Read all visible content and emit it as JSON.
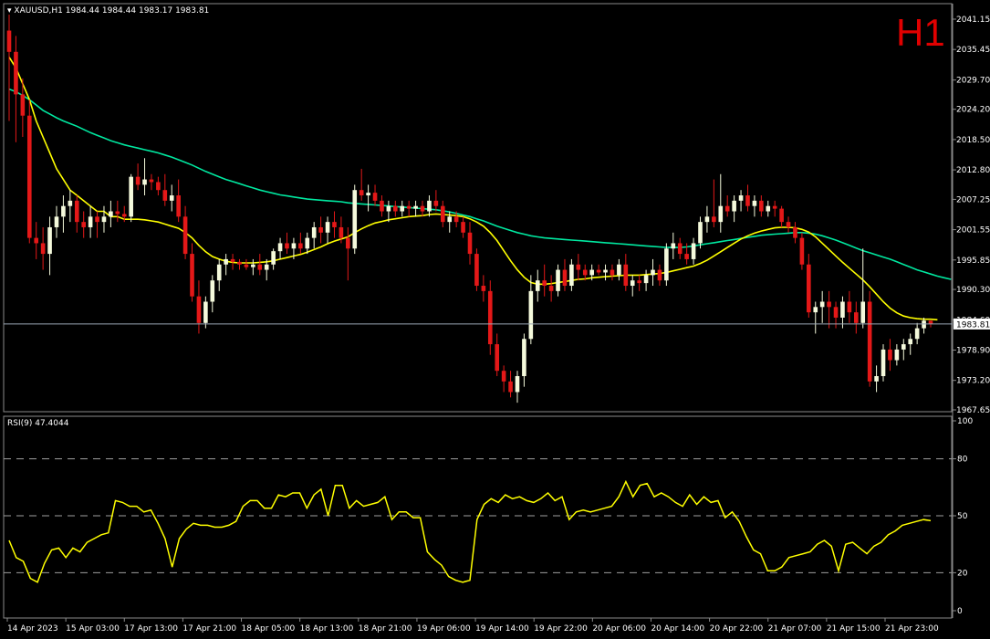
{
  "header": {
    "symbol": "XAUUSD,H1",
    "open": "1984.44",
    "high": "1984.44",
    "low": "1983.17",
    "close": "1983.81"
  },
  "timeframe_label": "H1",
  "price_axis": {
    "ticks": [
      "2041.15",
      "2035.45",
      "2029.70",
      "2024.20",
      "2018.50",
      "2012.80",
      "2007.25",
      "2001.55",
      "1995.85",
      "1990.30",
      "1984.60",
      "1978.90",
      "1973.20",
      "1967.65"
    ],
    "current_price": "1983.81"
  },
  "time_axis": [
    "14 Apr 2023",
    "15 Apr 03:00",
    "17 Apr 13:00",
    "17 Apr 21:00",
    "18 Apr 05:00",
    "18 Apr 13:00",
    "18 Apr 21:00",
    "19 Apr 06:00",
    "19 Apr 14:00",
    "19 Apr 22:00",
    "20 Apr 06:00",
    "20 Apr 14:00",
    "20 Apr 22:00",
    "21 Apr 07:00",
    "21 Apr 15:00",
    "21 Apr 23:00"
  ],
  "rsi": {
    "label": "RSI(9) 47.4044",
    "axis_ticks": [
      "100",
      "80",
      "50",
      "20",
      "0"
    ],
    "levels": [
      80,
      50,
      20
    ]
  },
  "colors": {
    "background": "#000000",
    "bull_candle": "#f5fadc",
    "bear_candle": "#e41818",
    "ma_fast": "#ffff00",
    "ma_slow": "#00e8a0",
    "rsi_line": "#ffff00",
    "grid": "#8a8a8a",
    "axis_text": "#ffffff",
    "timeframe": "#e00000"
  },
  "chart_data": {
    "type": "candlestick",
    "price_range": [
      1967.65,
      2041.15
    ],
    "candles": [
      [
        2039.0,
        2042.0,
        2022.0,
        2035.0
      ],
      [
        2035.0,
        2038.0,
        2018.0,
        2027.0
      ],
      [
        2027.0,
        2030.0,
        2019.0,
        2023.0
      ],
      [
        2023.0,
        2026.0,
        1999.0,
        2000.0
      ],
      [
        2000.0,
        2003.0,
        1996.0,
        1999.0
      ],
      [
        1999.0,
        2002.0,
        1994.0,
        1997.0
      ],
      [
        1997.0,
        2004.0,
        1993.0,
        2002.0
      ],
      [
        2002.0,
        2006.0,
        2000.0,
        2004.0
      ],
      [
        2004.0,
        2008.0,
        2001.0,
        2006.0
      ],
      [
        2006.0,
        2009.0,
        2003.0,
        2007.0
      ],
      [
        2007.0,
        2008.0,
        2001.0,
        2003.0
      ],
      [
        2003.0,
        2005.0,
        2000.0,
        2002.0
      ],
      [
        2002.0,
        2006.0,
        2000.0,
        2004.0
      ],
      [
        2004.0,
        2005.0,
        2000.0,
        2003.0
      ],
      [
        2003.0,
        2006.0,
        2001.0,
        2004.0
      ],
      [
        2004.0,
        2007.0,
        2002.0,
        2005.0
      ],
      [
        2005.0,
        2007.0,
        2003.0,
        2004.5
      ],
      [
        2004.5,
        2006.0,
        2003.0,
        2004.0
      ],
      [
        2004.0,
        2012.0,
        2003.0,
        2011.5
      ],
      [
        2011.5,
        2014.0,
        2009.0,
        2010.0
      ],
      [
        2010.0,
        2015.0,
        2008.0,
        2011.0
      ],
      [
        2011.0,
        2012.0,
        2009.0,
        2010.5
      ],
      [
        2010.5,
        2011.5,
        2008.0,
        2009.0
      ],
      [
        2009.0,
        2012.0,
        2006.0,
        2007.0
      ],
      [
        2007.0,
        2010.0,
        2005.0,
        2008.0
      ],
      [
        2008.0,
        2011.0,
        2003.0,
        2004.0
      ],
      [
        2004.0,
        2006.0,
        1996.0,
        1997.0
      ],
      [
        1997.0,
        1999.0,
        1988.0,
        1989.0
      ],
      [
        1989.0,
        1992.0,
        1982.0,
        1984.0
      ],
      [
        1984.0,
        1989.0,
        1983.0,
        1988.0
      ],
      [
        1988.0,
        1993.0,
        1986.0,
        1992.0
      ],
      [
        1992.0,
        1996.0,
        1990.0,
        1995.0
      ],
      [
        1995.0,
        1997.0,
        1993.0,
        1996.0
      ],
      [
        1996.0,
        1997.0,
        1994.0,
        1995.5
      ],
      [
        1995.5,
        1996.0,
        1994.0,
        1995.0
      ],
      [
        1995.0,
        1996.0,
        1994.0,
        1994.5
      ],
      [
        1994.5,
        1996.0,
        1993.0,
        1995.0
      ],
      [
        1995.0,
        1997.0,
        1993.0,
        1994.0
      ],
      [
        1994.0,
        1996.0,
        1992.0,
        1995.0
      ],
      [
        1995.0,
        1998.0,
        1994.0,
        1997.5
      ],
      [
        1997.5,
        2000.0,
        1996.0,
        1999.0
      ],
      [
        1999.0,
        2001.0,
        1997.0,
        1998.0
      ],
      [
        1998.0,
        2000.0,
        1996.0,
        1999.0
      ],
      [
        1999.0,
        2001.0,
        1997.0,
        1998.0
      ],
      [
        1998.0,
        2001.0,
        1997.0,
        2000.0
      ],
      [
        2000.0,
        2003.0,
        1998.0,
        2002.0
      ],
      [
        2002.0,
        2004.0,
        1999.0,
        2001.0
      ],
      [
        2001.0,
        2004.0,
        1999.0,
        2003.0
      ],
      [
        2003.0,
        2005.0,
        2000.0,
        2002.0
      ],
      [
        2002.0,
        2004.0,
        1999.0,
        2000.0
      ],
      [
        2000.0,
        2002.0,
        1992.0,
        1998.0
      ],
      [
        1998.0,
        2010.0,
        1997.0,
        2009.0
      ],
      [
        2009.0,
        2013.0,
        2007.0,
        2008.0
      ],
      [
        2008.0,
        2010.0,
        2005.0,
        2008.5
      ],
      [
        2008.5,
        2010.0,
        2006.0,
        2007.0
      ],
      [
        2007.0,
        2008.0,
        2004.0,
        2005.0
      ],
      [
        2005.0,
        2007.0,
        2003.0,
        2006.0
      ],
      [
        2006.0,
        2007.0,
        2004.0,
        2005.0
      ],
      [
        2005.0,
        2007.0,
        2004.0,
        2006.0
      ],
      [
        2006.0,
        2007.0,
        2004.0,
        2005.5
      ],
      [
        2005.5,
        2007.0,
        2004.0,
        2006.0
      ],
      [
        2006.0,
        2007.0,
        2004.0,
        2005.0
      ],
      [
        2005.0,
        2008.0,
        2004.0,
        2007.0
      ],
      [
        2007.0,
        2009.0,
        2005.0,
        2006.0
      ],
      [
        2006.0,
        2007.0,
        2002.0,
        2003.0
      ],
      [
        2003.0,
        2005.0,
        2001.0,
        2004.0
      ],
      [
        2004.0,
        2005.0,
        2002.0,
        2003.0
      ],
      [
        2003.0,
        2004.0,
        2000.0,
        2001.0
      ],
      [
        2001.0,
        2003.0,
        1995.0,
        1997.0
      ],
      [
        1997.0,
        1998.0,
        1990.0,
        1991.0
      ],
      [
        1991.0,
        1993.0,
        1988.0,
        1990.0
      ],
      [
        1990.0,
        1992.0,
        1978.0,
        1980.0
      ],
      [
        1980.0,
        1982.0,
        1974.0,
        1975.0
      ],
      [
        1975.0,
        1976.0,
        1971.0,
        1973.0
      ],
      [
        1973.0,
        1975.0,
        1970.0,
        1971.0
      ],
      [
        1971.0,
        1975.0,
        1969.0,
        1974.0
      ],
      [
        1974.0,
        1982.0,
        1972.0,
        1981.0
      ],
      [
        1981.0,
        1993.0,
        1980.0,
        1990.0
      ],
      [
        1990.0,
        1994.0,
        1988.0,
        1992.0
      ],
      [
        1992.0,
        1995.0,
        1989.0,
        1991.0
      ],
      [
        1991.0,
        1993.0,
        1988.0,
        1990.0
      ],
      [
        1990.0,
        1995.0,
        1989.0,
        1994.0
      ],
      [
        1994.0,
        1996.0,
        1990.0,
        1991.0
      ],
      [
        1991.0,
        1996.0,
        1990.0,
        1995.0
      ],
      [
        1995.0,
        1997.0,
        1992.0,
        1994.0
      ],
      [
        1994.0,
        1995.0,
        1992.0,
        1993.0
      ],
      [
        1993.0,
        1995.0,
        1992.0,
        1994.0
      ],
      [
        1994.0,
        1995.0,
        1993.0,
        1993.5
      ],
      [
        1993.5,
        1995.0,
        1992.0,
        1994.0
      ],
      [
        1994.0,
        1995.0,
        1992.0,
        1993.0
      ],
      [
        1993.0,
        1996.0,
        1992.0,
        1995.0
      ],
      [
        1995.0,
        1997.0,
        1990.0,
        1991.0
      ],
      [
        1991.0,
        1993.0,
        1989.0,
        1992.0
      ],
      [
        1992.0,
        1993.0,
        1990.0,
        1991.5
      ],
      [
        1991.5,
        1994.0,
        1990.0,
        1993.0
      ],
      [
        1993.0,
        1996.0,
        1991.0,
        1994.0
      ],
      [
        1994.0,
        1995.0,
        1991.0,
        1992.0
      ],
      [
        1992.0,
        1999.0,
        1991.0,
        1998.0
      ],
      [
        1998.0,
        2001.0,
        1996.0,
        1999.0
      ],
      [
        1999.0,
        2000.0,
        1996.0,
        1997.0
      ],
      [
        1997.0,
        1999.0,
        1995.0,
        1996.0
      ],
      [
        1996.0,
        2000.0,
        1995.0,
        1999.0
      ],
      [
        1999.0,
        2004.0,
        1998.0,
        2003.0
      ],
      [
        2003.0,
        2006.0,
        2001.0,
        2004.0
      ],
      [
        2004.0,
        2011.0,
        2002.0,
        2003.0
      ],
      [
        2003.0,
        2012.0,
        2001.0,
        2006.0
      ],
      [
        2006.0,
        2008.0,
        2004.0,
        2005.0
      ],
      [
        2005.0,
        2008.0,
        2003.0,
        2007.0
      ],
      [
        2007.0,
        2009.0,
        2005.0,
        2008.0
      ],
      [
        2008.0,
        2010.0,
        2005.0,
        2006.0
      ],
      [
        2006.0,
        2008.0,
        2004.0,
        2007.0
      ],
      [
        2007.0,
        2008.0,
        2004.0,
        2005.0
      ],
      [
        2005.0,
        2007.0,
        2004.0,
        2006.0
      ],
      [
        2006.0,
        2007.0,
        2004.0,
        2005.5
      ],
      [
        2005.5,
        2006.0,
        2002.0,
        2003.0
      ],
      [
        2003.0,
        2004.0,
        2001.0,
        2002.0
      ],
      [
        2002.0,
        2003.0,
        1999.0,
        2000.0
      ],
      [
        2000.0,
        2001.0,
        1994.0,
        1995.0
      ],
      [
        1995.0,
        1997.0,
        1985.0,
        1986.0
      ],
      [
        1986.0,
        1988.0,
        1982.0,
        1987.0
      ],
      [
        1987.0,
        1990.0,
        1984.0,
        1988.0
      ],
      [
        1988.0,
        1990.0,
        1983.0,
        1987.0
      ],
      [
        1987.0,
        1988.0,
        1983.0,
        1985.0
      ],
      [
        1985.0,
        1989.0,
        1983.0,
        1988.0
      ],
      [
        1988.0,
        1990.0,
        1984.0,
        1986.0
      ],
      [
        1986.0,
        1988.0,
        1982.0,
        1984.0
      ],
      [
        1984.0,
        1998.0,
        1983.0,
        1988.0
      ],
      [
        1988.0,
        1990.0,
        1972.0,
        1973.0
      ],
      [
        1973.0,
        1976.0,
        1971.0,
        1974.0
      ],
      [
        1974.0,
        1980.0,
        1973.0,
        1979.0
      ],
      [
        1979.0,
        1981.0,
        1975.0,
        1977.0
      ],
      [
        1977.0,
        1980.0,
        1976.0,
        1979.0
      ],
      [
        1979.0,
        1981.0,
        1977.0,
        1980.0
      ],
      [
        1980.0,
        1982.0,
        1978.0,
        1981.0
      ],
      [
        1981.0,
        1984.0,
        1980.0,
        1983.0
      ],
      [
        1983.0,
        1985.0,
        1982.0,
        1984.44
      ],
      [
        1984.44,
        1984.44,
        1983.17,
        1983.81
      ]
    ],
    "ma_fast": [
      2034,
      2032,
      2029,
      2026,
      2022,
      2019,
      2016,
      2013,
      2011,
      2009,
      2008,
      2007,
      2006,
      2005,
      2005,
      2004,
      2004,
      2003.5,
      2003.5,
      2003.5,
      2003.4,
      2003.2,
      2003,
      2002.6,
      2002.2,
      2001.8,
      2001,
      2000,
      1998.6,
      1997.4,
      1996.5,
      1996,
      1995.6,
      1995.4,
      1995.3,
      1995.3,
      1995.3,
      1995.4,
      1995.5,
      1995.7,
      1996,
      1996.3,
      1996.6,
      1996.9,
      1997.3,
      1997.8,
      1998.3,
      1998.9,
      1999.4,
      1999.8,
      2000.2,
      2001,
      2001.7,
      2002.3,
      2002.8,
      2003.1,
      2003.4,
      2003.6,
      2003.8,
      2004,
      2004.1,
      2004.2,
      2004.4,
      2004.5,
      2004.4,
      2004.3,
      2004.2,
      2004,
      2003.6,
      2003,
      2002.2,
      2001,
      1999.5,
      1997.6,
      1995.7,
      1994,
      1992.6,
      1991.6,
      1991.3,
      1991.3,
      1991.4,
      1991.6,
      1991.8,
      1992,
      1992.2,
      1992.3,
      1992.5,
      1992.6,
      1992.7,
      1992.8,
      1992.9,
      1993,
      1993,
      1993,
      1993.1,
      1993.2,
      1993.3,
      1993.5,
      1993.8,
      1994.1,
      1994.4,
      1994.7,
      1995.2,
      1995.8,
      1996.6,
      1997.4,
      1998.2,
      1999,
      1999.8,
      2000.4,
      2000.9,
      2001.3,
      2001.6,
      2001.9,
      2002,
      2002,
      2001.9,
      2001.6,
      2001.1,
      2000.2,
      1999,
      1997.8,
      1996.6,
      1995.4,
      1994.3,
      1993.2,
      1992.1,
      1990.8,
      1989.4,
      1988,
      1986.8,
      1985.9,
      1985.3,
      1985,
      1984.8,
      1984.7,
      1984.7,
      1984.6
    ],
    "ma_slow": [
      2028,
      2027.5,
      2026.8,
      2026,
      2025,
      2024,
      2023.3,
      2022.6,
      2022,
      2021.5,
      2021,
      2020.4,
      2019.8,
      2019.3,
      2018.8,
      2018.3,
      2017.9,
      2017.5,
      2017.2,
      2016.9,
      2016.6,
      2016.3,
      2016,
      2015.6,
      2015.2,
      2014.7,
      2014.2,
      2013.7,
      2013.1,
      2012.5,
      2012,
      2011.5,
      2011,
      2010.6,
      2010.2,
      2009.8,
      2009.4,
      2009,
      2008.7,
      2008.4,
      2008.1,
      2007.9,
      2007.7,
      2007.5,
      2007.3,
      2007.2,
      2007.1,
      2007,
      2006.9,
      2006.8,
      2006.6,
      2006.5,
      2006.4,
      2006.3,
      2006.2,
      2006.1,
      2006,
      2005.9,
      2005.8,
      2005.7,
      2005.6,
      2005.5,
      2005.4,
      2005.3,
      2005.1,
      2004.9,
      2004.6,
      2004.3,
      2004,
      2003.6,
      2003.2,
      2002.7,
      2002.2,
      2001.8,
      2001.4,
      2001,
      2000.7,
      2000.4,
      2000.2,
      2000,
      1999.9,
      1999.8,
      1999.7,
      1999.6,
      1999.5,
      1999.4,
      1999.3,
      1999.2,
      1999.1,
      1999,
      1998.9,
      1998.8,
      1998.7,
      1998.6,
      1998.5,
      1998.4,
      1998.3,
      1998.2,
      1998.2,
      1998.2,
      1998.3,
      1998.5,
      1998.7,
      1998.9,
      1999.1,
      1999.3,
      1999.5,
      1999.7,
      1999.9,
      2000.1,
      2000.3,
      2000.5,
      2000.6,
      2000.7,
      2000.8,
      2000.9,
      2001,
      2001,
      2000.9,
      2000.7,
      2000.4,
      2000,
      1999.6,
      1999.1,
      1998.6,
      1998.1,
      1997.6,
      1997.2,
      1996.8,
      1996.4,
      1996,
      1995.5,
      1995,
      1994.5,
      1994,
      1993.6,
      1993.2,
      1992.8,
      1992.5,
      1992.2
    ],
    "rsi_values": [
      37,
      28,
      26,
      17,
      15,
      25,
      32,
      33,
      28,
      33,
      31,
      36,
      38,
      40,
      41,
      58,
      57,
      55,
      55,
      52,
      53,
      46,
      38,
      23,
      38,
      43,
      46,
      45,
      45,
      44,
      44,
      45,
      47,
      55,
      58,
      58,
      54,
      54,
      61,
      60,
      62,
      62,
      54,
      61,
      64,
      50,
      66,
      66,
      54,
      58,
      55,
      56,
      57,
      60,
      48,
      52,
      52,
      49,
      49,
      31,
      27,
      24,
      18,
      16,
      15,
      16,
      48,
      56,
      59,
      57,
      61,
      59,
      60,
      58,
      57,
      59,
      62,
      58,
      60,
      48,
      52,
      53,
      52,
      53,
      54,
      55,
      60,
      68,
      60,
      66,
      67,
      60,
      62,
      60,
      57,
      55,
      61,
      56,
      60,
      57,
      58,
      49,
      52,
      47,
      39,
      32,
      30,
      21,
      21,
      23,
      28,
      29,
      30,
      31,
      35,
      37,
      34,
      21,
      35,
      36,
      33,
      30,
      34,
      36,
      40,
      42,
      45,
      46,
      47,
      48,
      47.4
    ],
    "x_labels": [
      "14 Apr 2023",
      "15 Apr 03:00",
      "17 Apr 13:00",
      "17 Apr 21:00",
      "18 Apr 05:00",
      "18 Apr 13:00",
      "18 Apr 21:00",
      "19 Apr 06:00",
      "19 Apr 14:00",
      "19 Apr 22:00",
      "20 Apr 06:00",
      "20 Apr 14:00",
      "20 Apr 22:00",
      "21 Apr 07:00",
      "21 Apr 15:00",
      "21 Apr 23:00"
    ]
  }
}
